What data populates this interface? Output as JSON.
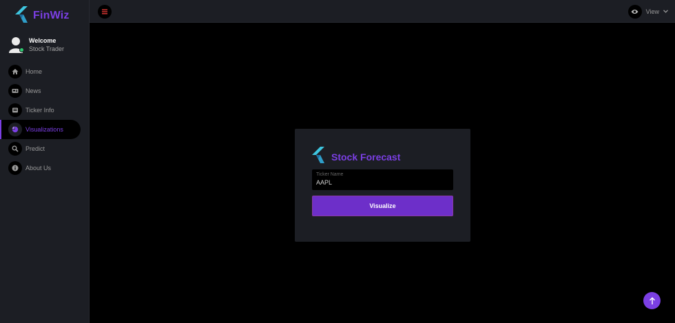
{
  "brand": {
    "name": "FinWiz",
    "accent": "#7b3fe4"
  },
  "profile": {
    "welcome": "Welcome",
    "role": "Stock Trader",
    "status": "online"
  },
  "sidebar": {
    "items": [
      {
        "label": "Home",
        "icon": "home-icon",
        "active": false
      },
      {
        "label": "News",
        "icon": "newspaper-icon",
        "active": false
      },
      {
        "label": "Ticker Info",
        "icon": "list-icon",
        "active": false
      },
      {
        "label": "Visualizations",
        "icon": "pie-chart-icon",
        "active": true
      },
      {
        "label": "Predict",
        "icon": "search-icon",
        "active": false
      },
      {
        "label": "About Us",
        "icon": "info-icon",
        "active": false
      }
    ]
  },
  "topbar": {
    "menu_icon": "hamburger-icon",
    "view_label": "View",
    "view_icon": "eye-icon"
  },
  "card": {
    "title": "Stock Forecast",
    "ticker_label": "Ticker Name",
    "ticker_value": "AAPL",
    "button_label": "Visualize"
  },
  "colors": {
    "sidebar_bg": "#1c1e24",
    "main_bg": "#000000",
    "button": "#6d2fc9",
    "menu_icon": "#e53935"
  },
  "scroll_top_icon": "arrow-up-icon"
}
